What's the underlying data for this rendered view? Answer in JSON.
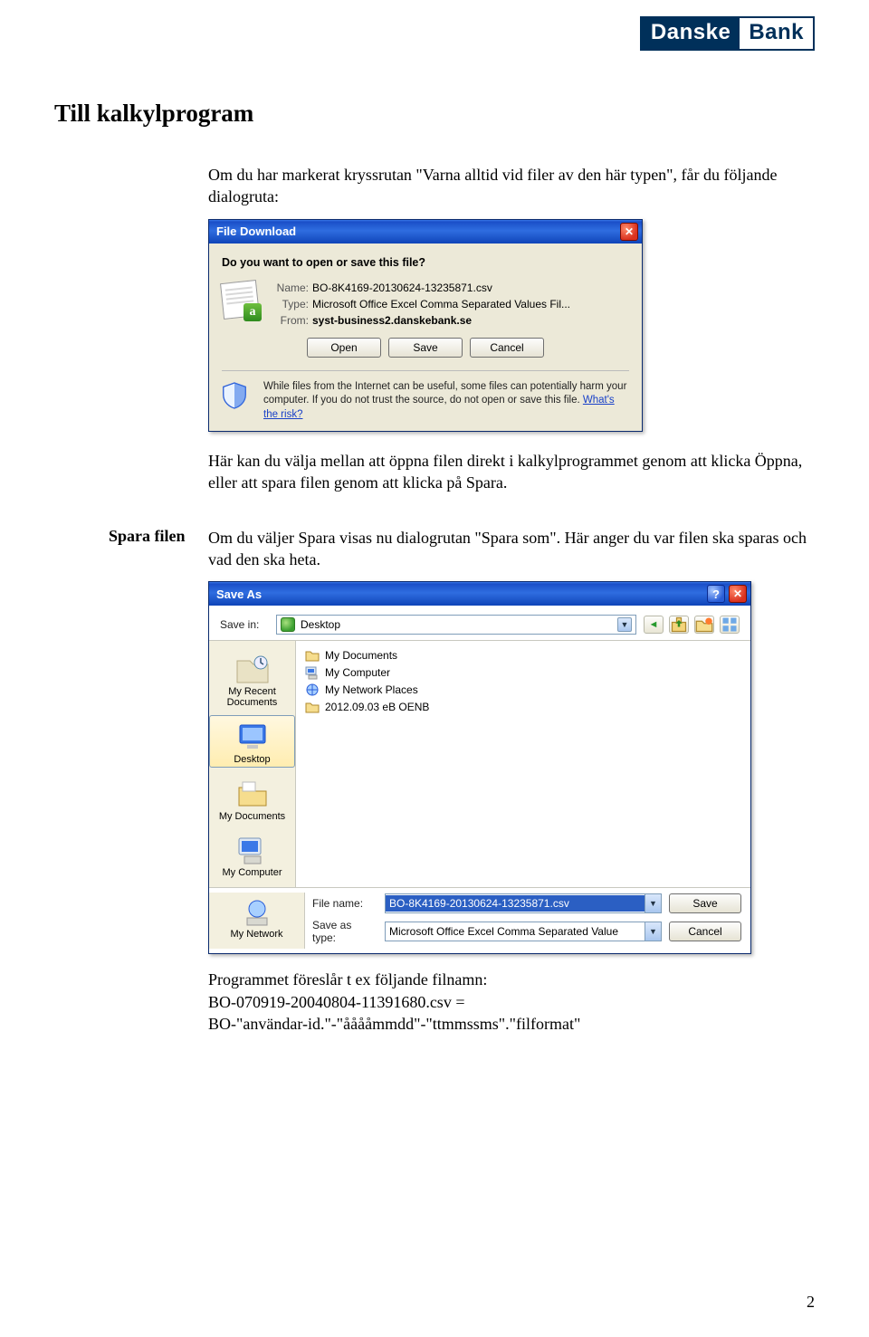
{
  "logo": {
    "word1": "Danske",
    "word2": "Bank"
  },
  "heading": "Till kalkylprogram",
  "intro_text": "Om du har markerat kryssrutan \"Varna alltid vid filer av den här typen\", får du följande dialogruta:",
  "dialog1": {
    "title": "File Download",
    "question": "Do you want to open or save this file?",
    "labels": {
      "name": "Name:",
      "type": "Type:",
      "from": "From:"
    },
    "name_value": "BO-8K4169-20130624-13235871.csv",
    "type_value": "Microsoft Office Excel Comma Separated Values Fil...",
    "from_value": "syst-business2.danskebank.se",
    "buttons": {
      "open": "Open",
      "save": "Save",
      "cancel": "Cancel"
    },
    "warning_text": "While files from the Internet can be useful, some files can potentially harm your computer. If you do not trust the source, do not open or save this file. ",
    "warning_link": "What's the risk?"
  },
  "after_dialog1_text": "Här kan du välja mellan att öppna filen direkt i kalkylprogrammet genom att klicka Öppna, eller att spara filen genom att klicka på Spara.",
  "section2": {
    "side_label": "Spara filen",
    "text": "Om du väljer Spara visas nu dialogrutan \"Spara som\". Här anger du var filen ska sparas och vad den ska heta."
  },
  "dialog2": {
    "title": "Save As",
    "savein_label": "Save in:",
    "savein_value": "Desktop",
    "toolbar_icons": {
      "back": "back-icon",
      "up": "up-one-level-icon",
      "new_folder": "new-folder-icon",
      "views": "views-icon"
    },
    "places": {
      "recent": "My Recent Documents",
      "desktop": "Desktop",
      "mydocs": "My Documents",
      "mycomputer": "My Computer",
      "network": "My Network"
    },
    "list_items": [
      "My Documents",
      "My Computer",
      "My Network Places",
      "2012.09.03 eB OENB"
    ],
    "filename_label": "File name:",
    "filename_value": "BO-8K4169-20130624-13235871.csv",
    "saveas_label": "Save as type:",
    "saveas_value": "Microsoft Office Excel Comma Separated Value",
    "buttons": {
      "save": "Save",
      "cancel": "Cancel"
    }
  },
  "suggest_line1": "Programmet föreslår t ex följande filnamn:",
  "suggest_line2": "BO-070919-20040804-11391680.csv =",
  "suggest_line3": "BO-\"användar-id.\"-\"ååååmmdd\"-\"ttmmssms\".\"filformat\"",
  "page_number": "2"
}
